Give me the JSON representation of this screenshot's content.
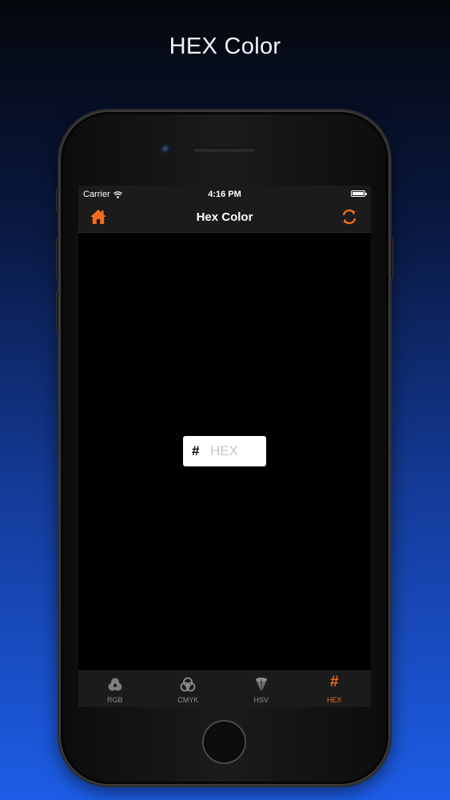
{
  "promo": {
    "title": "HEX Color"
  },
  "status_bar": {
    "carrier": "Carrier",
    "time": "4:16 PM",
    "battery_level": 1.0
  },
  "nav": {
    "title": "Hex Color",
    "left_icon": "home-icon",
    "right_icon": "swap-arrows-icon"
  },
  "hex_input": {
    "prefix": "#",
    "placeholder": "HEX",
    "value": ""
  },
  "tabs": [
    {
      "label": "RGB",
      "icon": "rgb-circles-icon",
      "active": false
    },
    {
      "label": "CMYK",
      "icon": "cmyk-circles-icon",
      "active": false
    },
    {
      "label": "HSV",
      "icon": "hsv-cone-icon",
      "active": false
    },
    {
      "label": "HEX",
      "icon": "hash-icon",
      "active": true
    }
  ],
  "colors": {
    "accent": "#f26b1d",
    "bar_background": "#1b1b1b",
    "screen_background": "#000000",
    "tab_inactive": "#8e8e93"
  }
}
